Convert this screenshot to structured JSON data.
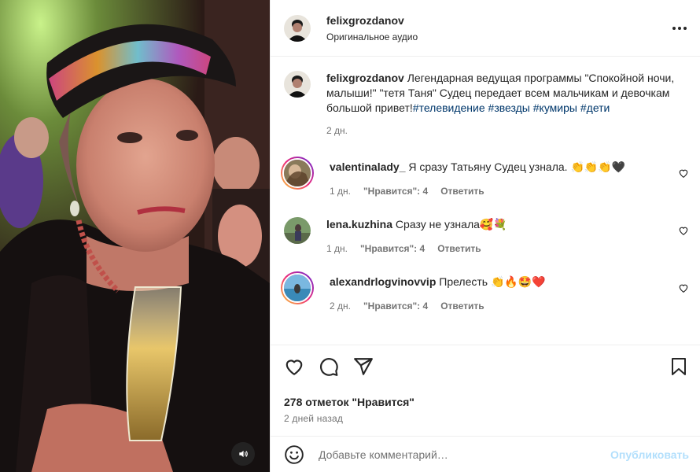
{
  "post": {
    "author": "felixgrozdanov",
    "audio": "Оригинальное аудио"
  },
  "caption": {
    "username": "felixgrozdanov",
    "text": "Легендарная ведущая программы \"Спокойной ночи, малыши!\" \"тетя Таня\" Судец передает всем мальчикам и девочкам большой привет!",
    "hashtags": [
      "#телевидение",
      "#звезды",
      "#кумиры",
      "#дети"
    ],
    "time": "2 дн."
  },
  "comments": [
    {
      "username": "valentinalady_",
      "text": "Я сразу Татьяну Судец узнала. 👏👏👏🖤",
      "time": "1 дн.",
      "likes": "\"Нравится\": 4",
      "reply": "Ответить",
      "story_ring": true
    },
    {
      "username": "lena.kuzhina",
      "text": "Сразу не узнала🥰💐",
      "time": "1 дн.",
      "likes": "\"Нравится\": 4",
      "reply": "Ответить",
      "story_ring": false
    },
    {
      "username": "alexandrlogvinovvip",
      "text": "Прелесть 👏🔥🤩❤️",
      "time": "2 дн.",
      "likes": "\"Нравится\": 4",
      "reply": "Ответить",
      "story_ring": true
    }
  ],
  "engagement": {
    "likes_text": "278 отметок \"Нравится\"",
    "date": "2 дней назад"
  },
  "composer": {
    "placeholder": "Добавьте комментарий…",
    "publish_label": "Опубликовать"
  },
  "icons": {
    "more": "more-options-icon",
    "like": "heart-icon",
    "comment": "comment-bubble-icon",
    "share": "paper-plane-icon",
    "save": "bookmark-icon",
    "emoji": "emoji-smile-icon",
    "sound": "speaker-icon"
  },
  "colors": {
    "hashtag": "#00376b",
    "publish_disabled": "#b2dffc",
    "secondary_text": "#737373"
  }
}
